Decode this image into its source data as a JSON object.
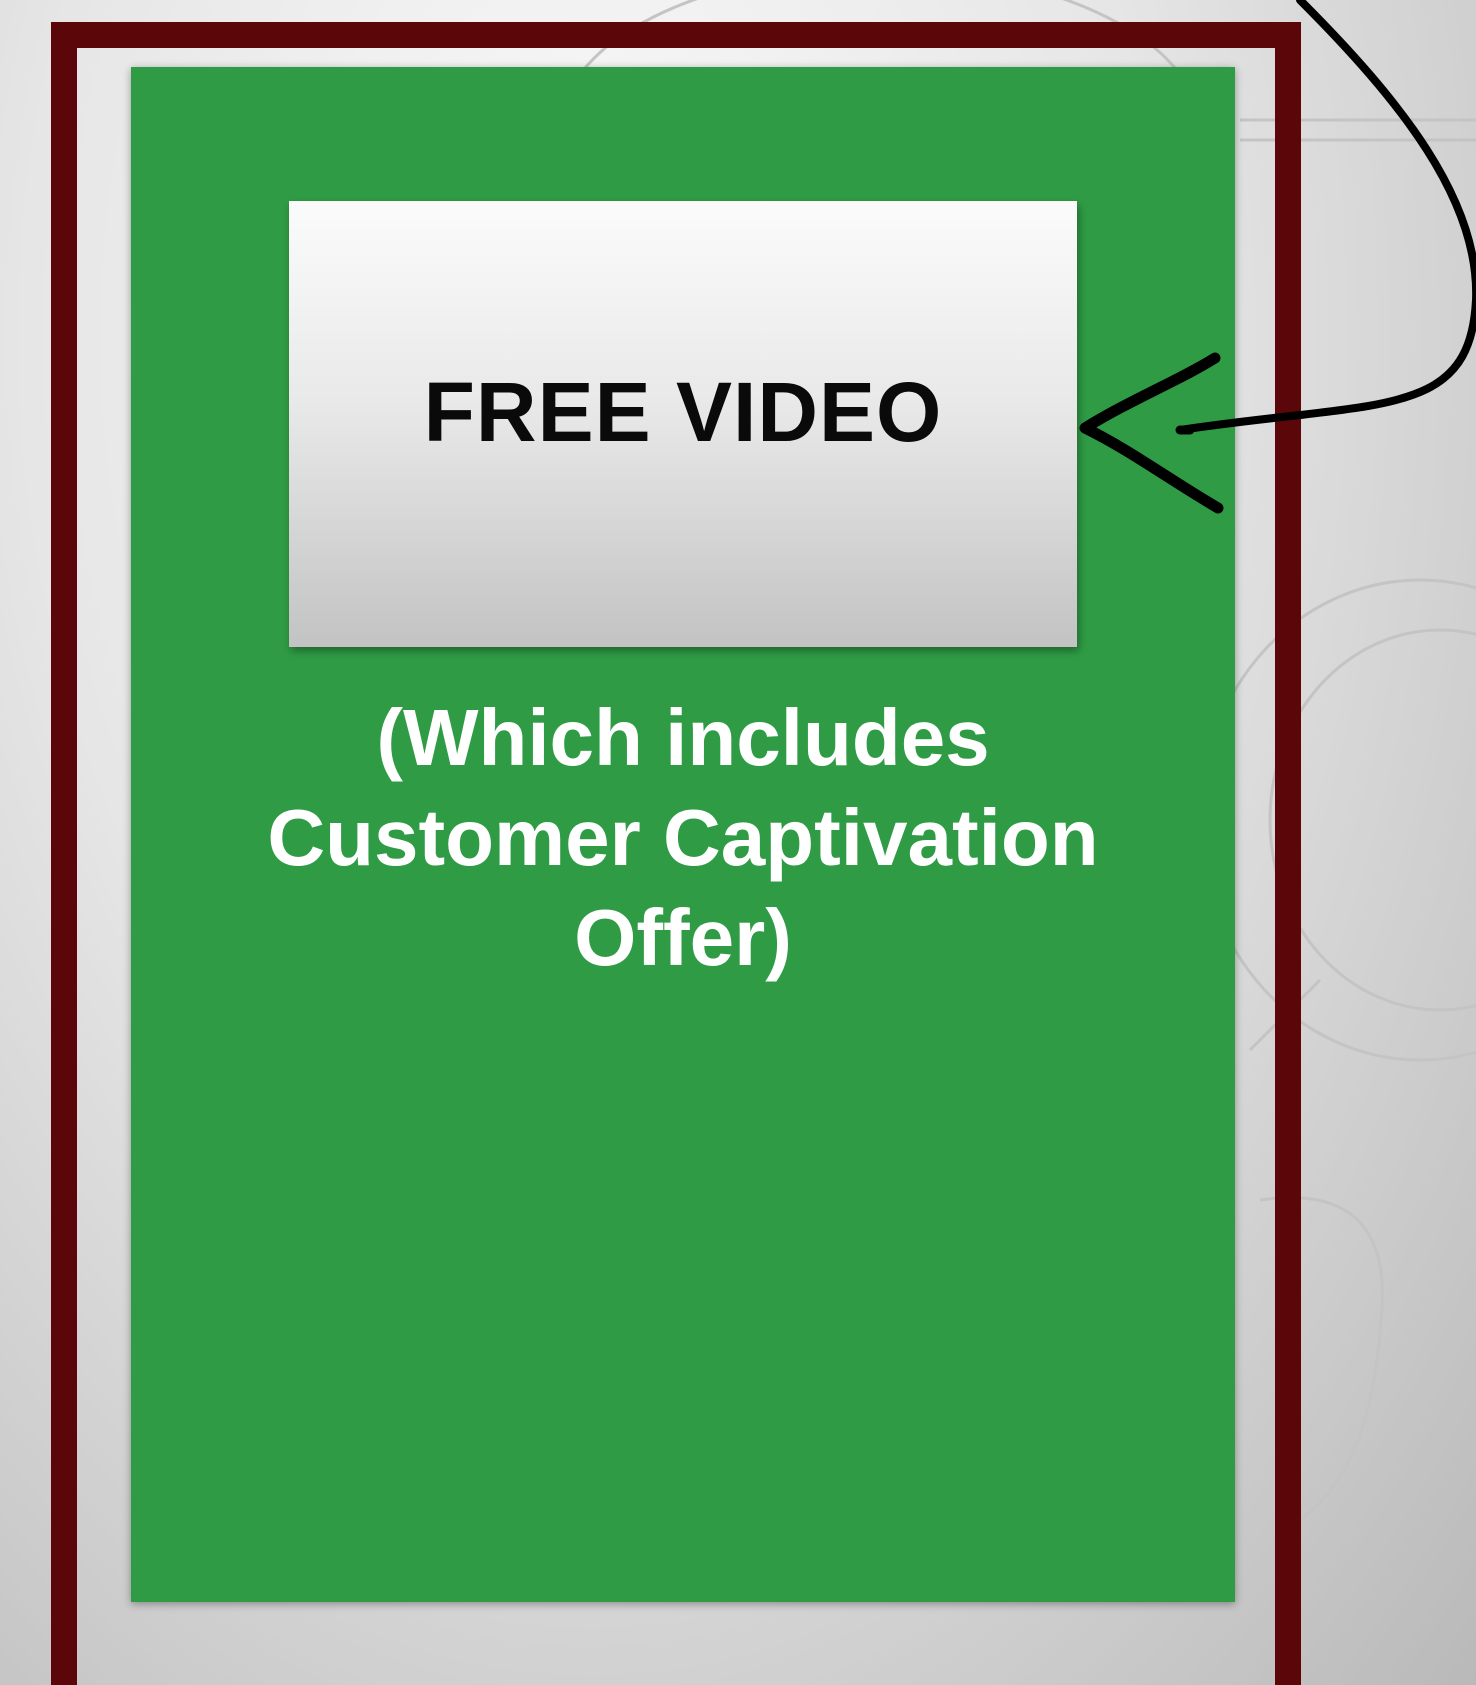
{
  "video_box": {
    "label": "FREE VIDEO"
  },
  "caption": {
    "text": "(Which includes\nCustomer Captivation\nOffer)"
  },
  "colors": {
    "frame": "#5b0609",
    "panel": "#2f9c45",
    "caption_text": "#ffffff",
    "arrow": "#000000"
  },
  "icons": {
    "arrow": "hand-drawn-arrow-icon"
  }
}
